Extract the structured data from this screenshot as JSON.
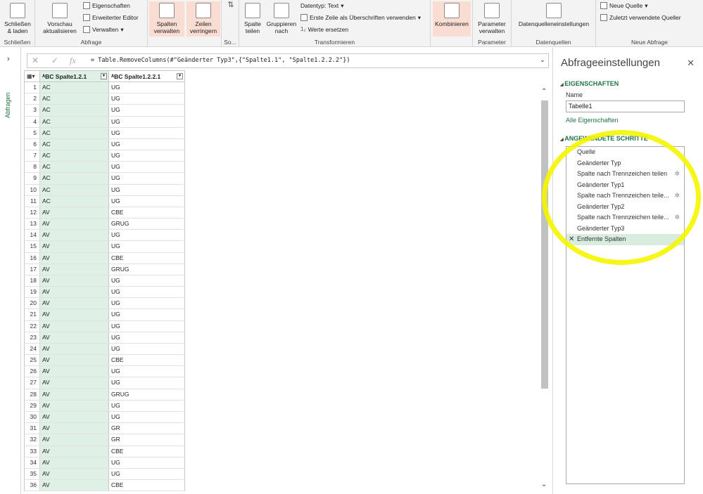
{
  "ribbon": {
    "close_load": "Schließen\n& laden",
    "close_group": "Schließen",
    "preview": "Vorschau\naktualisieren",
    "properties": "Eigenschaften",
    "advanced_editor": "Erweiterter Editor",
    "manage": "Verwalten",
    "query_group": "Abfrage",
    "manage_columns": "Spalten\nverwalten",
    "reduce_rows": "Zeilen\nverringern",
    "sort_group": "So...",
    "split_column": "Spalte\nteilen",
    "group_by": "Gruppieren\nnach",
    "data_type": "Datentyp: Text",
    "first_row_headers": "Erste Zeile als Überschriften verwenden",
    "replace_values": "Werte ersetzen",
    "transform_group": "Transformieren",
    "combine": "Kombinieren",
    "manage_params": "Parameter\nverwalten",
    "params_group": "Parameter",
    "data_source_settings": "Datenquelleneinstellungen",
    "data_sources_group": "Datenquellen",
    "new_source": "Neue Quelle",
    "recent_sources": "Zuletzt verwendete Queller",
    "new_query_group": "Neue Abfrage"
  },
  "nav": {
    "label": "Abfragen"
  },
  "formula": "= Table.RemoveColumns(#\"Geänderter Typ3\",{\"Spalte1.1\", \"Spalte1.2.2.2\"})",
  "grid": {
    "columns": [
      "Spalte1.2.1",
      "Spalte1.2.2.1"
    ],
    "rows": [
      [
        "AC",
        "UG"
      ],
      [
        "AC",
        "UG"
      ],
      [
        "AC",
        "UG"
      ],
      [
        "AC",
        "UG"
      ],
      [
        "AC",
        "UG"
      ],
      [
        "AC",
        "UG"
      ],
      [
        "AC",
        "UG"
      ],
      [
        "AC",
        "UG"
      ],
      [
        "AC",
        "UG"
      ],
      [
        "AC",
        "UG"
      ],
      [
        "AC",
        "UG"
      ],
      [
        "AV",
        "CBE"
      ],
      [
        "AV",
        "GRUG"
      ],
      [
        "AV",
        "UG"
      ],
      [
        "AV",
        "UG"
      ],
      [
        "AV",
        "CBE"
      ],
      [
        "AV",
        "GRUG"
      ],
      [
        "AV",
        "UG"
      ],
      [
        "AV",
        "UG"
      ],
      [
        "AV",
        "UG"
      ],
      [
        "AV",
        "UG"
      ],
      [
        "AV",
        "UG"
      ],
      [
        "AV",
        "UG"
      ],
      [
        "AV",
        "UG"
      ],
      [
        "AV",
        "CBE"
      ],
      [
        "AV",
        "UG"
      ],
      [
        "AV",
        "UG"
      ],
      [
        "AV",
        "GRUG"
      ],
      [
        "AV",
        "UG"
      ],
      [
        "AV",
        "UG"
      ],
      [
        "AV",
        "GR"
      ],
      [
        "AV",
        "GR"
      ],
      [
        "AV",
        "CBE"
      ],
      [
        "AV",
        "UG"
      ],
      [
        "AV",
        "UG"
      ],
      [
        "AV",
        "CBE"
      ]
    ]
  },
  "panel": {
    "title": "Abfrageeinstellungen",
    "properties_header": "EIGENSCHAFTEN",
    "name_label": "Name",
    "name_value": "Tabelle1",
    "all_properties": "Alle Eigenschaften",
    "steps_header": "ANGEWENDETE SCHRITTE",
    "steps": [
      {
        "label": "Quelle",
        "gear": false
      },
      {
        "label": "Geänderter Typ",
        "gear": false
      },
      {
        "label": "Spalte nach Trennzeichen teilen",
        "gear": true
      },
      {
        "label": "Geänderter Typ1",
        "gear": false
      },
      {
        "label": "Spalte nach Trennzeichen teile...",
        "gear": true
      },
      {
        "label": "Geänderter Typ2",
        "gear": false
      },
      {
        "label": "Spalte nach Trennzeichen teile...",
        "gear": true
      },
      {
        "label": "Geänderter Typ3",
        "gear": false
      },
      {
        "label": "Entfernte Spalten",
        "gear": false,
        "selected": true
      }
    ]
  },
  "colors": {
    "accent": "#217346",
    "selected_col": "#dff0e6",
    "highlight": "#f5f500"
  }
}
